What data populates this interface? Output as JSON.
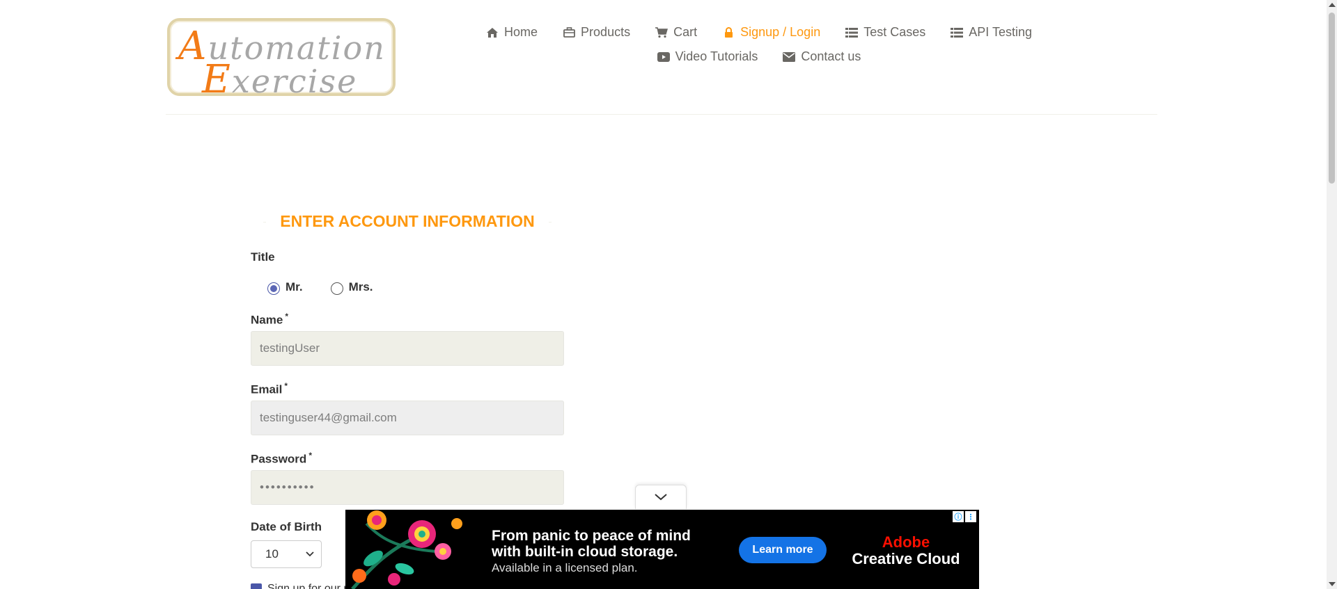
{
  "logo": {
    "line1_cap": "A",
    "line1_rest": "utomation",
    "line2_cap": "E",
    "line2_rest": "xercise"
  },
  "nav": {
    "row1": [
      {
        "label": "Home",
        "icon": "home-icon"
      },
      {
        "label": "Products",
        "icon": "products-icon"
      },
      {
        "label": "Cart",
        "icon": "cart-icon"
      },
      {
        "label": "Signup / Login",
        "icon": "lock-icon",
        "active": true
      },
      {
        "label": "Test Cases",
        "icon": "list-icon"
      },
      {
        "label": "API Testing",
        "icon": "list-icon"
      }
    ],
    "row2": [
      {
        "label": "Video Tutorials",
        "icon": "youtube-icon"
      },
      {
        "label": "Contact us",
        "icon": "envelope-icon"
      }
    ]
  },
  "form": {
    "section_title": "Enter Account Information",
    "title_label": "Title",
    "title_options": [
      "Mr.",
      "Mrs."
    ],
    "title_selected": "Mr.",
    "name_label": "Name",
    "name_value": "testingUser",
    "email_label": "Email",
    "email_value": "testinguser44@gmail.com",
    "password_label": "Password",
    "password_value": "••••••••••",
    "required_mark": "*",
    "dob_label": "Date of Birth",
    "dob_day": "10",
    "newsletter_label": "Sign up for our newsletter!"
  },
  "ad": {
    "headline_1": "From panic to peace of mind",
    "headline_2": "with built-in cloud storage.",
    "sub": "Available in a licensed plan.",
    "button": "Learn more",
    "brand_1": "Adobe",
    "brand_2": "Creative Cloud"
  },
  "colors": {
    "accent": "#fe980f",
    "text": "#696763",
    "ad_button": "#1473e6",
    "adobe_red": "#fa0f00"
  }
}
